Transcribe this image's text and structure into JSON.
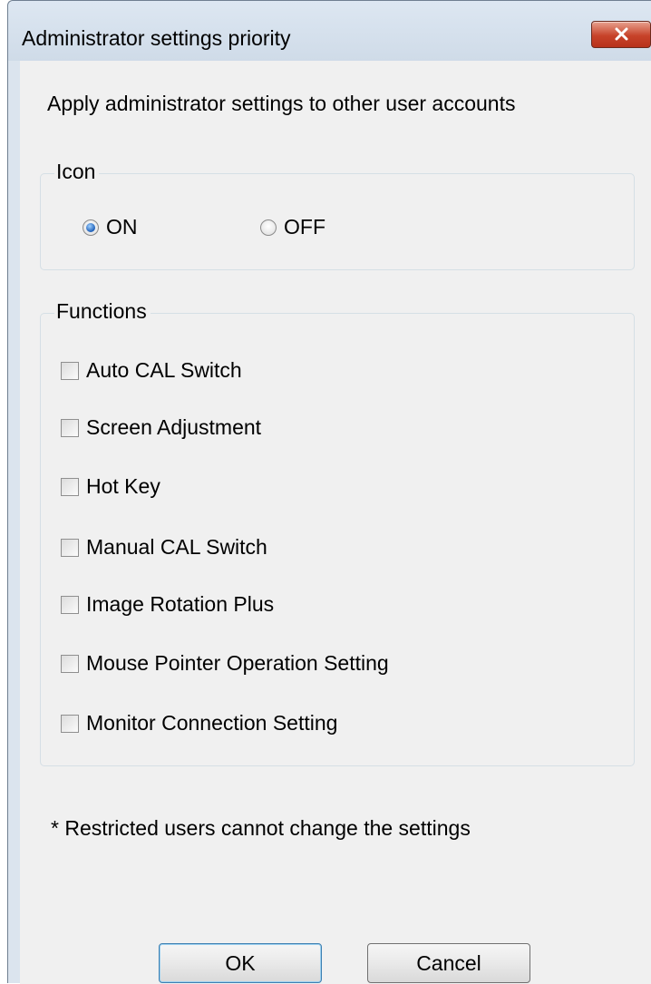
{
  "window": {
    "title": "Administrator settings priority",
    "close_icon": "close-x-icon"
  },
  "heading": "Apply administrator settings to other user accounts",
  "icon_group": {
    "legend": "Icon",
    "options": [
      {
        "label": "ON",
        "selected": true
      },
      {
        "label": "OFF",
        "selected": false
      }
    ]
  },
  "functions_group": {
    "legend": "Functions",
    "items": [
      {
        "label": "Auto CAL Switch",
        "checked": false
      },
      {
        "label": "Screen Adjustment",
        "checked": false
      },
      {
        "label": "Hot Key",
        "checked": false
      },
      {
        "label": "Manual CAL Switch",
        "checked": false
      },
      {
        "label": "Image Rotation Plus",
        "checked": false
      },
      {
        "label": "Mouse Pointer Operation Setting",
        "checked": false
      },
      {
        "label": "Monitor Connection Setting",
        "checked": false
      }
    ]
  },
  "note": "* Restricted users cannot change the settings",
  "buttons": {
    "ok": "OK",
    "cancel": "Cancel"
  },
  "colors": {
    "title_bar": "#dbe4ee",
    "client_bg": "#f0f0f0",
    "close_button": "#c7432a",
    "radio_selected": "#1d5fb8"
  }
}
